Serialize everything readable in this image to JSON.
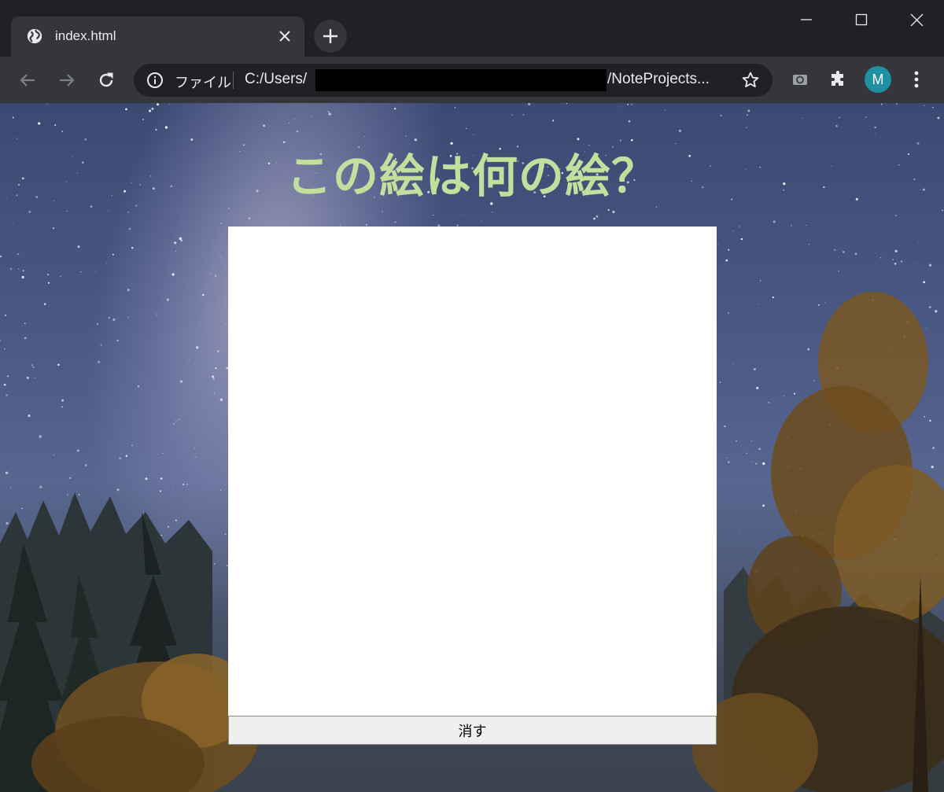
{
  "browser": {
    "tab": {
      "title": "index.html"
    },
    "omnibox": {
      "scheme_label": "ファイル",
      "url_prefix": "C:/Users/",
      "url_suffix": "/NoteProjects..."
    },
    "profile": {
      "initial": "M"
    },
    "icons": {
      "favicon": "globe-icon",
      "tab_close": "close-icon",
      "new_tab": "plus-icon",
      "minimize": "minimize-icon",
      "maximize": "maximize-icon",
      "close_window": "close-icon",
      "back": "arrow-left-icon",
      "forward": "arrow-right-icon",
      "reload": "reload-icon",
      "site_info": "info-icon",
      "bookmark": "star-icon",
      "extension_a": "extension-icon",
      "extensions": "puzzle-icon",
      "menu": "kebab-menu-icon"
    },
    "colors": {
      "frame": "#202124",
      "toolbar": "#35363a",
      "avatar": "#1f8fa3"
    }
  },
  "page": {
    "title": "この絵は何の絵？",
    "clear_button_label": "消す",
    "colors": {
      "title": "#c3df9e",
      "canvas": "#ffffff",
      "button": "#efefef"
    }
  }
}
